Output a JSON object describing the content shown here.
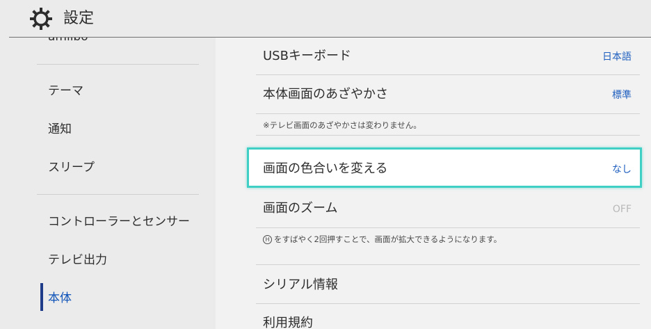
{
  "header": {
    "title": "設定",
    "icon": "gear-icon"
  },
  "sidebar": {
    "items": [
      {
        "label": "amiibo"
      },
      {
        "label": "テーマ"
      },
      {
        "label": "通知"
      },
      {
        "label": "スリープ"
      },
      {
        "label": "コントローラーとセンサー"
      },
      {
        "label": "テレビ出力"
      },
      {
        "label": "本体"
      }
    ]
  },
  "content": {
    "usb_keyboard": {
      "label": "USBキーボード",
      "value": "日本語"
    },
    "brightness": {
      "label": "本体画面のあざやかさ",
      "value": "標準",
      "note": "※テレビ画面のあざやかさは変わりません。"
    },
    "color_filter": {
      "label": "画面の色合いを変える",
      "value": "なし"
    },
    "zoom": {
      "label": "画面のズーム",
      "value": "OFF",
      "note_button": "H",
      "note": "をすばやく2回押すことで、画面が拡大できるようになります。"
    },
    "serial": {
      "label": "シリアル情報"
    },
    "terms": {
      "label": "利用規約"
    }
  },
  "colors": {
    "accent_blue": "#1f5fbf",
    "focus_border": "#3fcfc4",
    "active_indicator": "#1f3c8a"
  }
}
